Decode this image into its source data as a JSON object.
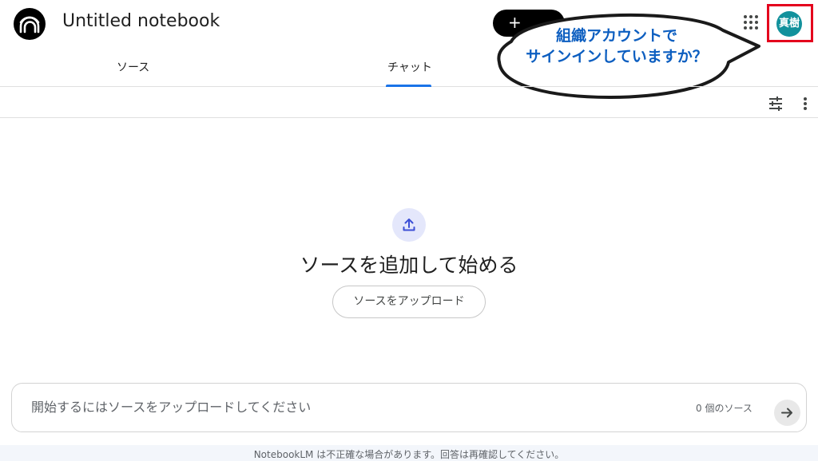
{
  "header": {
    "notebook_title": "Untitled notebook",
    "create_label": "+",
    "account_initials": "真樹"
  },
  "callout": {
    "line1": "組織アカウントで",
    "line2": "サインインしていますか？",
    "color": "#0c5ec0",
    "highlight_color": "#e4001d"
  },
  "tabs": [
    {
      "label": "ソース",
      "active": false
    },
    {
      "label": "チャット",
      "active": true
    }
  ],
  "chat_toolbar": {
    "icons": [
      "tune-icon",
      "more-vert-icon"
    ]
  },
  "empty_state": {
    "icon": "upload-icon",
    "title": "ソースを追加して始める",
    "upload_button": "ソースをアップロード"
  },
  "chat_input": {
    "placeholder": "開始するにはソースをアップロードしてください",
    "source_count": "0 個のソース",
    "send_icon": "arrow-forward-icon"
  },
  "footer": {
    "disclaimer": "NotebookLM は不正確な場合があります。回答は再確認してください。"
  },
  "colors": {
    "accent": "#1a73e8",
    "avatar_bg": "#12919c",
    "upload_circle_bg": "#e4e7fb"
  }
}
